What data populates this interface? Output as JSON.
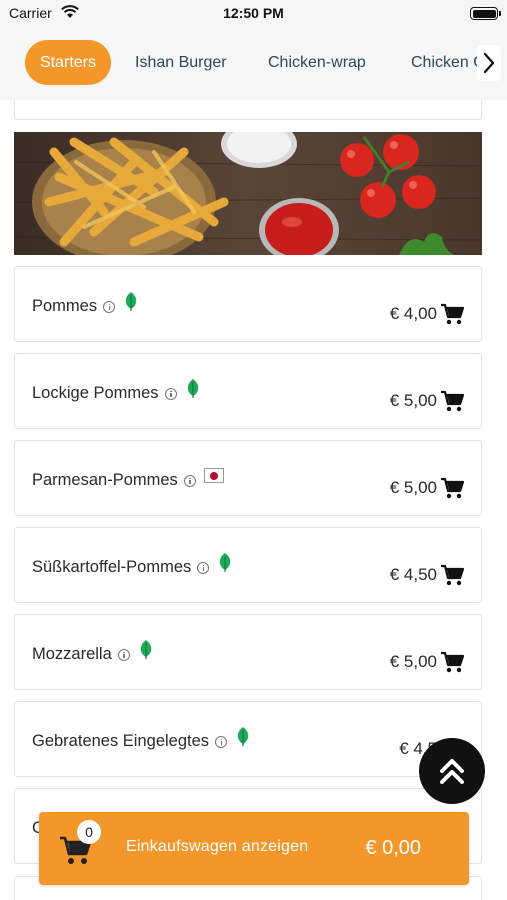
{
  "status_bar": {
    "carrier": "Carrier",
    "time": "12:50 PM"
  },
  "tabs": [
    {
      "label": "Starters",
      "active": true
    },
    {
      "label": "Ishan Burger",
      "active": false
    },
    {
      "label": "Chicken-wrap",
      "active": false
    },
    {
      "label": "Chicken G",
      "active": false
    }
  ],
  "icons": {
    "next_tab": "chevron-right-icon",
    "info": "info-icon",
    "vegetarian": "leaf-icon",
    "flag": "japan-flag-icon",
    "add_to_cart": "cart-icon",
    "scroll_top": "double-chevron-up-icon"
  },
  "items": [
    {
      "name": "Pommes",
      "badge": "leaf",
      "price": "€ 4,00"
    },
    {
      "name": "Lockige Pommes",
      "badge": "leaf",
      "price": "€ 5,00"
    },
    {
      "name": "Parmesan-Pommes",
      "badge": "flag",
      "price": "€ 5,00"
    },
    {
      "name": "Süßkartoffel-Pommes",
      "badge": "leaf",
      "price": "€ 4,50"
    },
    {
      "name": "Mozzarella",
      "badge": "leaf",
      "price": "€ 5,00"
    },
    {
      "name": "Gebratenes Eingelegtes",
      "badge": "leaf",
      "price": "€ 4,5"
    },
    {
      "name": "C",
      "badge": "none",
      "price": ""
    }
  ],
  "cart": {
    "count": "0",
    "label": "Einkaufswagen anzeigen",
    "total": "€ 0,00"
  },
  "colors": {
    "accent": "#f4972a",
    "tab_text": "#2b4a5a",
    "leaf": "#1faa59"
  }
}
